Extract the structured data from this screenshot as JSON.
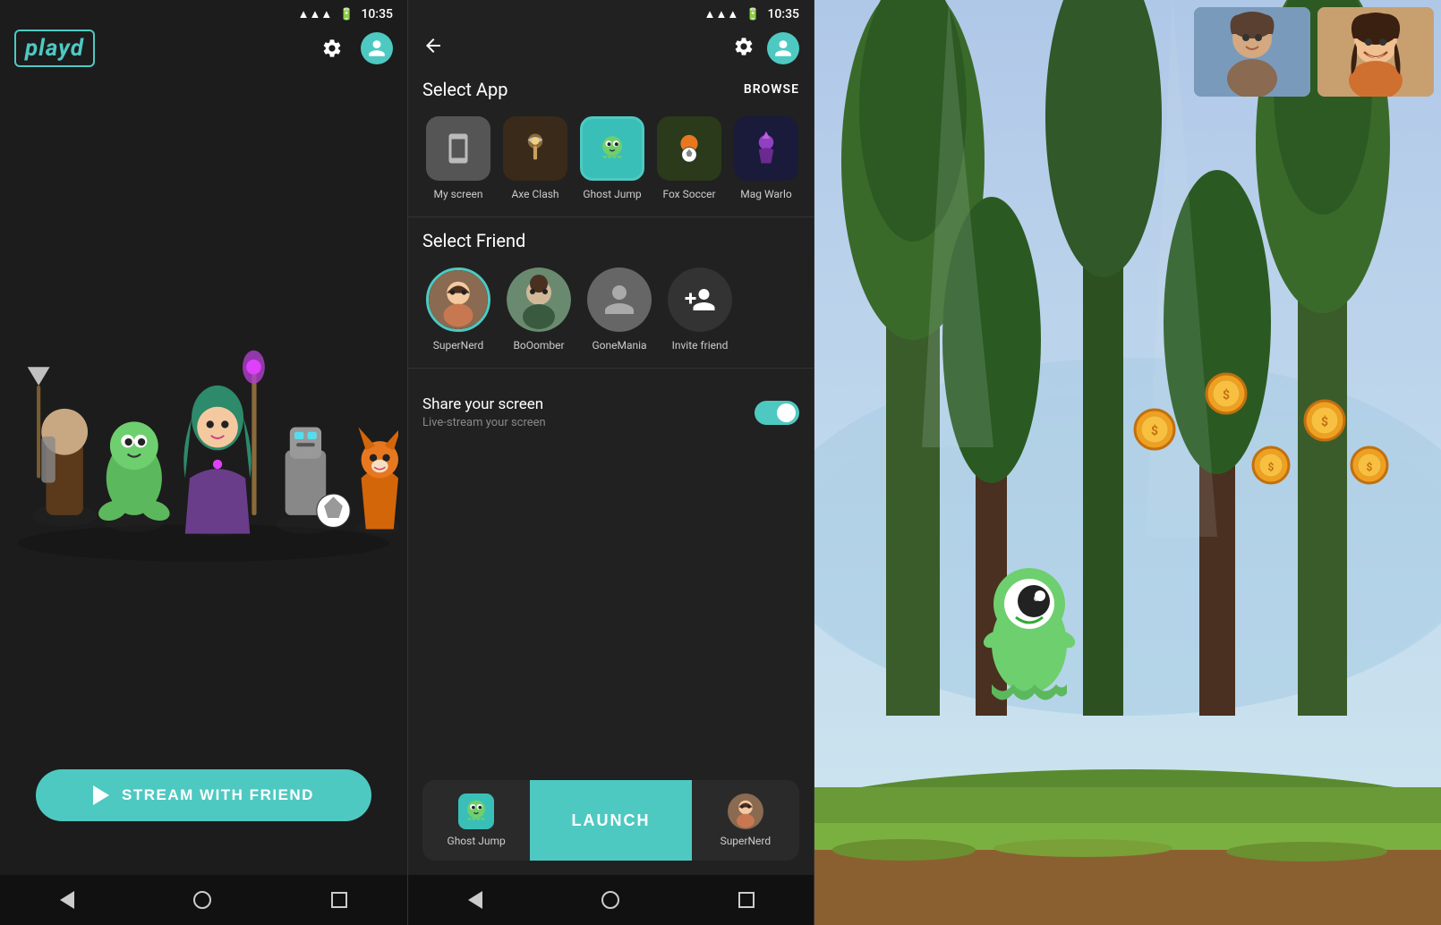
{
  "panel1": {
    "status": {
      "time": "10:35"
    },
    "logo": "playd",
    "stream_button_label": "STREAM WITH FRIEND"
  },
  "panel2": {
    "status": {
      "time": "10:35"
    },
    "select_app_label": "Select App",
    "browse_label": "BROWSE",
    "select_friend_label": "Select Friend",
    "share_screen_title": "Share your screen",
    "share_screen_subtitle": "Live-stream your screen",
    "apps": [
      {
        "name": "My screen",
        "icon_type": "phone"
      },
      {
        "name": "Axe Clash",
        "icon_type": "axe"
      },
      {
        "name": "Ghost Jump",
        "icon_type": "ghost",
        "selected": true
      },
      {
        "name": "Fox Soccer",
        "icon_type": "fox"
      },
      {
        "name": "Mag Warlo",
        "icon_type": "mage"
      }
    ],
    "friends": [
      {
        "name": "SuperNerd",
        "icon_type": "photo1",
        "selected": true
      },
      {
        "name": "BoOomber",
        "icon_type": "photo2"
      },
      {
        "name": "GoneMania",
        "icon_type": "generic"
      },
      {
        "name": "Invite friend",
        "icon_type": "invite"
      }
    ],
    "launch_label": "LAUNCH",
    "launch_app": "Ghost Jump",
    "launch_friend": "SuperNerd"
  },
  "panel3": {
    "game": "Ghost Jump"
  }
}
